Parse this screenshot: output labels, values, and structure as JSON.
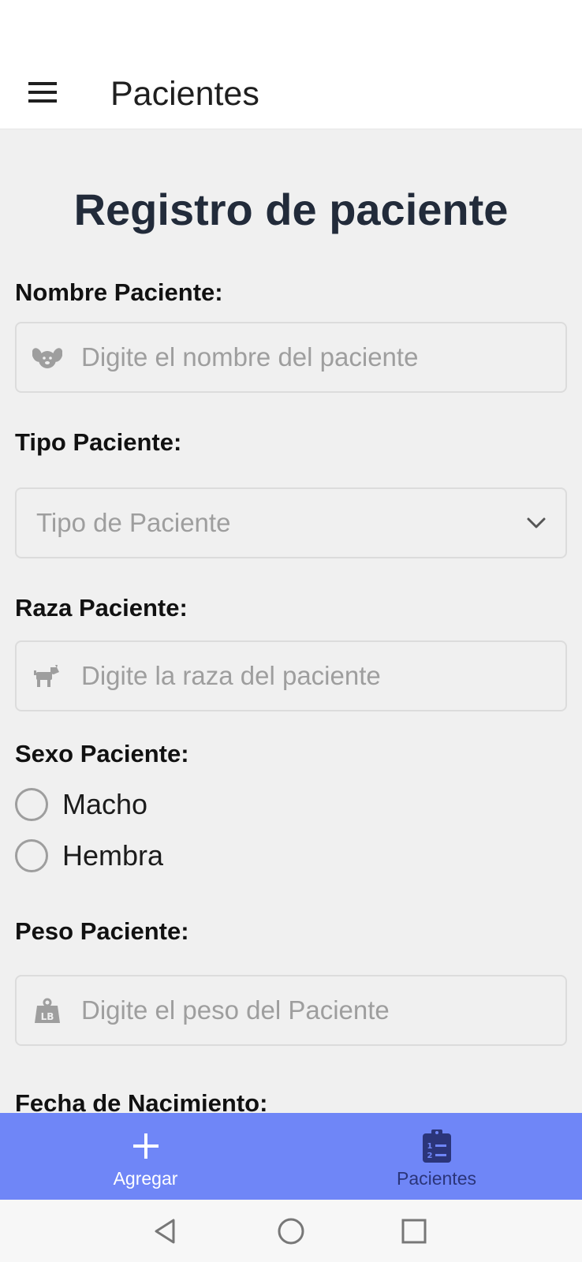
{
  "header": {
    "title": "Pacientes",
    "menu_icon": "hamburger-menu-icon"
  },
  "form": {
    "title": "Registro de paciente",
    "name": {
      "label": "Nombre Paciente:",
      "placeholder": "Digite el nombre del paciente",
      "icon": "dog-face-icon"
    },
    "type": {
      "label": "Tipo Paciente:",
      "placeholder": "Tipo de Paciente",
      "icon": "chevron-down-icon"
    },
    "breed": {
      "label": "Raza Paciente:",
      "placeholder": "Digite la raza del paciente",
      "icon": "dog-icon"
    },
    "sex": {
      "label": "Sexo Paciente:",
      "options": [
        {
          "label": "Macho",
          "selected": false
        },
        {
          "label": "Hembra",
          "selected": false
        }
      ]
    },
    "weight": {
      "label": "Peso Paciente:",
      "placeholder": "Digite el peso del Paciente",
      "icon": "weight-lb-icon"
    },
    "birthdate": {
      "label": "Fecha de Nacimiento:"
    }
  },
  "tabs": [
    {
      "label": "Agregar",
      "icon": "plus-icon",
      "active": true
    },
    {
      "label": "Pacientes",
      "icon": "clipboard-list-icon",
      "active": false
    }
  ],
  "colors": {
    "tab_bar": "#6f86f7",
    "title": "#222b3a",
    "placeholder": "#9e9e9e",
    "tab_inactive": "#2b357a"
  }
}
